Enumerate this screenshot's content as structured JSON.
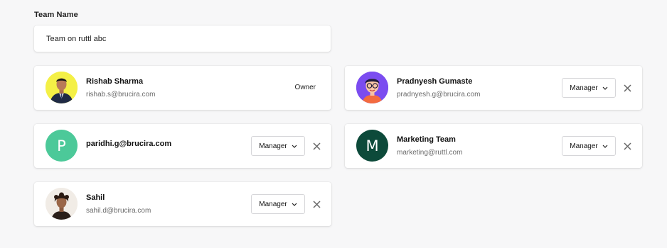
{
  "team": {
    "label": "Team Name",
    "value": "Team on ruttl abc"
  },
  "members": [
    {
      "name": "Rishab Sharma",
      "email": "rishab.s@brucira.com",
      "role": "Owner",
      "avatar": "photo-man-yellow-bg"
    },
    {
      "name": "Pradnyesh Gumaste",
      "email": "pradnyesh.g@brucira.com",
      "role": "Manager",
      "avatar": "illustrated-avatar-purple-bg"
    },
    {
      "name": "paridhi.g@brucira.com",
      "initial": "P",
      "role": "Manager",
      "avatar_color": "#4cc999"
    },
    {
      "name": "Marketing Team",
      "email": "marketing@ruttl.com",
      "initial": "M",
      "role": "Manager",
      "avatar_color": "#0d4a3a"
    },
    {
      "name": "Sahil",
      "email": "sahil.d@brucira.com",
      "role": "Manager",
      "avatar": "photo-man-curly-hair"
    }
  ],
  "icons": {
    "dropdown": "chevron-down-icon",
    "remove": "close-icon"
  }
}
